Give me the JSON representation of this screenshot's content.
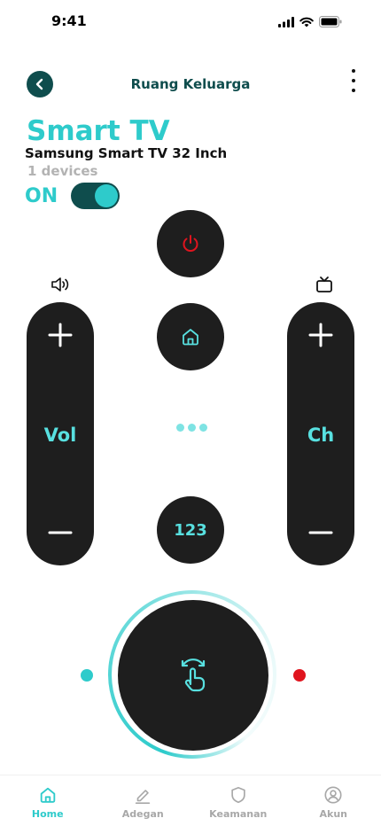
{
  "status_bar": {
    "time": "9:41",
    "icons": [
      "signal-icon",
      "wifi-icon",
      "battery-icon"
    ]
  },
  "header": {
    "title": "Ruang Keluarga",
    "back_icon": "chevron-left-icon",
    "more_icon": "more-vertical-icon"
  },
  "device": {
    "name": "Smart TV",
    "model": "Samsung Smart TV 32 Inch",
    "count": "1 devices",
    "state": "ON",
    "power_on": true
  },
  "remote": {
    "volume_label": "Vol",
    "channel_label": "Ch",
    "number_label": "123",
    "icons": [
      "power-icon",
      "home-icon",
      "volume-icon",
      "tv-icon",
      "plus-icon",
      "minus-icon",
      "touch-swipe-icon"
    ]
  },
  "nav": {
    "items": [
      {
        "label": "Home",
        "icon": "home-icon",
        "active": true
      },
      {
        "label": "Adegan",
        "icon": "edit-icon",
        "active": false
      },
      {
        "label": "Keamanan",
        "icon": "shield-icon",
        "active": false
      },
      {
        "label": "Akun",
        "icon": "user-icon",
        "active": false
      }
    ]
  },
  "colors": {
    "accent": "#2ecbcb",
    "dark_teal": "#0f4d4d",
    "button_dark": "#1e1e1e",
    "power_red": "#e0141e",
    "inactive_gray": "#a8a8a8"
  }
}
